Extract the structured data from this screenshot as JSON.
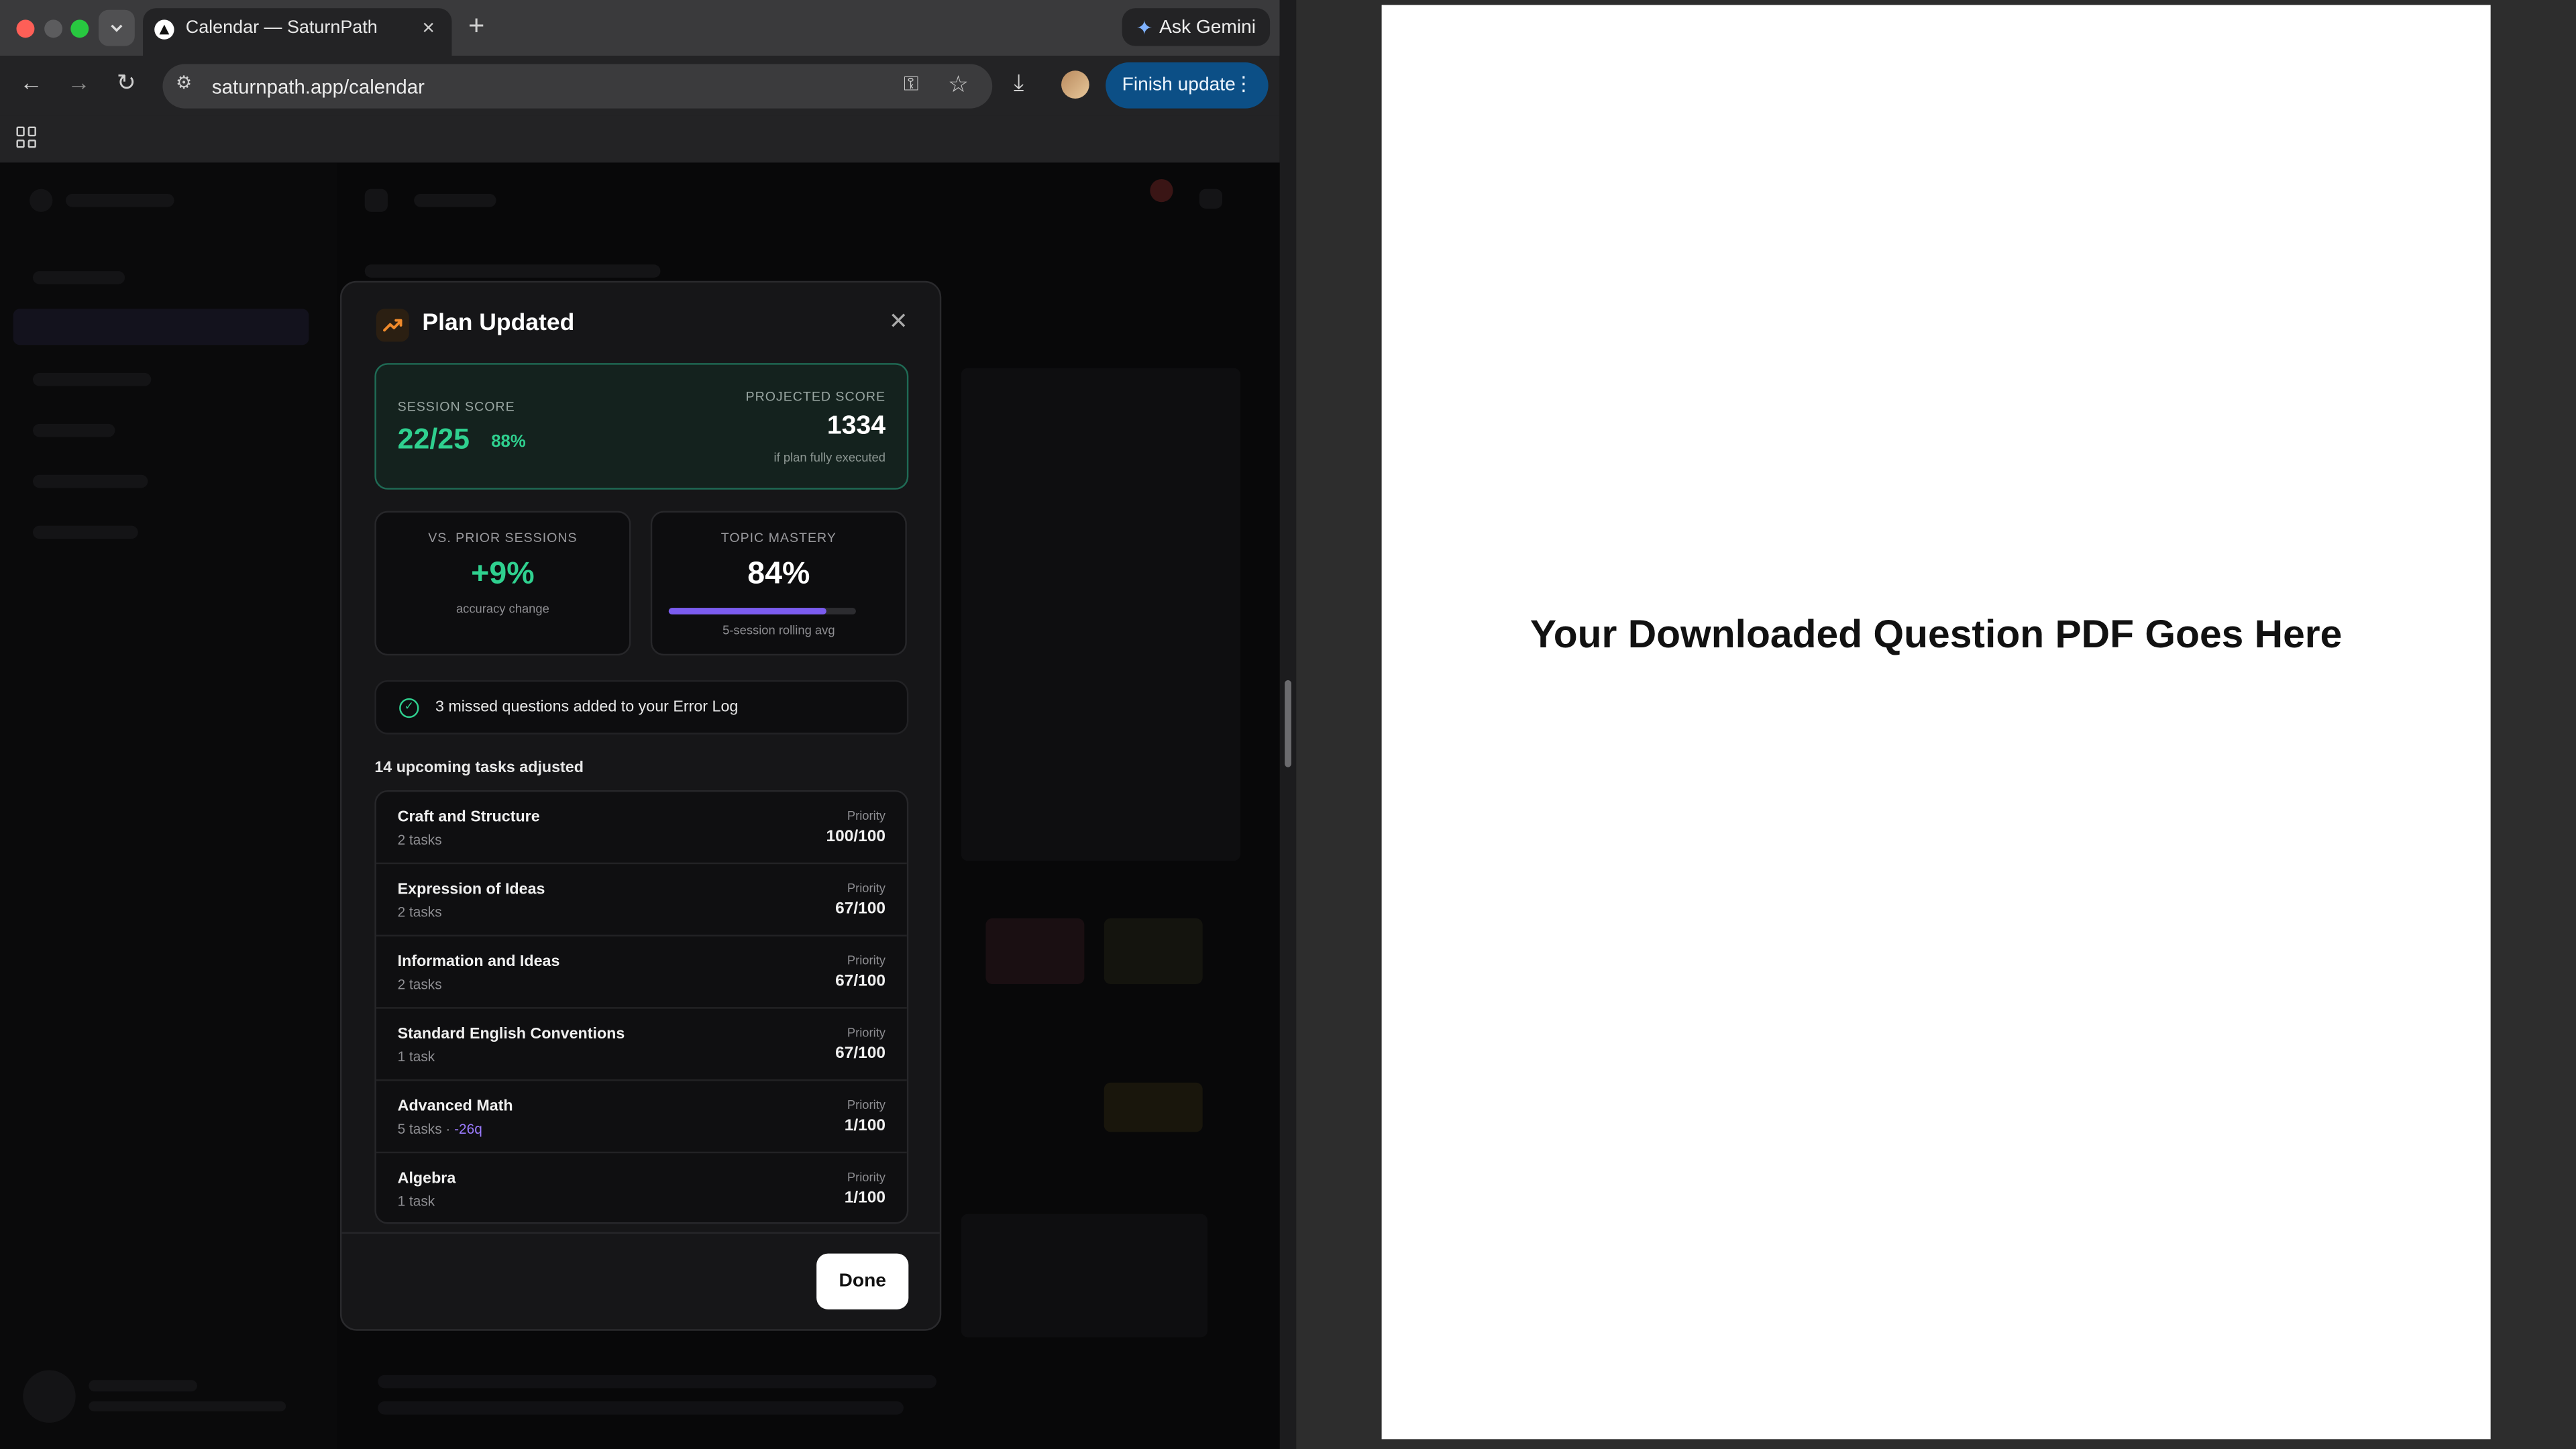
{
  "browser": {
    "tab_title": "Calendar — SaturnPath",
    "url": "saturnpath.app/calendar",
    "gemini_label": "Ask Gemini",
    "update_label": "Finish update"
  },
  "modal": {
    "title": "Plan Updated",
    "session_score_label": "SESSION SCORE",
    "session_score": "22/25",
    "session_pct": "88%",
    "projected_label": "PROJECTED SCORE",
    "projected_value": "1334",
    "projected_sub": "if plan fully executed",
    "prior_label": "VS. PRIOR SESSIONS",
    "prior_value": "+9%",
    "prior_sub": "accuracy change",
    "mastery_label": "TOPIC MASTERY",
    "mastery_value": "84%",
    "mastery_fraction": 0.84,
    "mastery_sub": "5-session rolling avg",
    "error_log_text": "3 missed questions added to your Error Log",
    "tasks_heading": "14 upcoming tasks adjusted",
    "priority_label": "Priority",
    "tasks": [
      {
        "name": "Craft and Structure",
        "count": "2 tasks",
        "delta": "",
        "priority": "100/100"
      },
      {
        "name": "Expression of Ideas",
        "count": "2 tasks",
        "delta": "",
        "priority": "67/100"
      },
      {
        "name": "Information and Ideas",
        "count": "2 tasks",
        "delta": "",
        "priority": "67/100"
      },
      {
        "name": "Standard English Conventions",
        "count": "1 task",
        "delta": "",
        "priority": "67/100"
      },
      {
        "name": "Advanced Math",
        "count": "5 tasks · ",
        "delta": "-26q",
        "priority": "1/100"
      },
      {
        "name": "Algebra",
        "count": "1 task",
        "delta": "",
        "priority": "1/100"
      }
    ],
    "done_label": "Done"
  },
  "pdf": {
    "placeholder": "Your Downloaded Question PDF Goes Here"
  },
  "colors": {
    "accent_green": "#2fd08f",
    "accent_purple": "#7b5cf0",
    "update_button": "#0c4f86"
  }
}
